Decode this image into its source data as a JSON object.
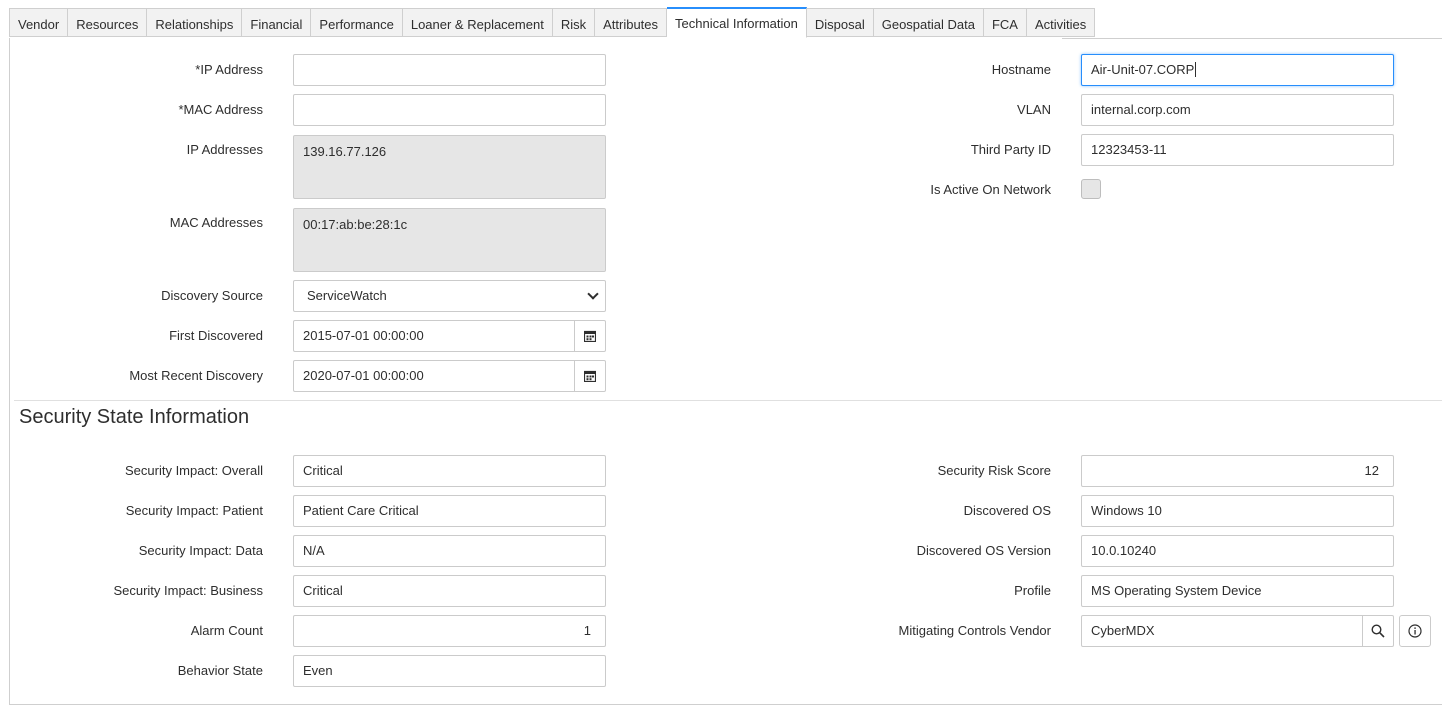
{
  "tabs": [
    "Vendor",
    "Resources",
    "Relationships",
    "Financial",
    "Performance",
    "Loaner & Replacement",
    "Risk",
    "Attributes",
    "Technical Information",
    "Disposal",
    "Geospatial Data",
    "FCA",
    "Activities"
  ],
  "active_tab": "Technical Information",
  "technical": {
    "ip_address": {
      "label": "*IP Address",
      "value": ""
    },
    "mac_address": {
      "label": "*MAC Address",
      "value": ""
    },
    "ip_addresses": {
      "label": "IP Addresses",
      "value": "139.16.77.126"
    },
    "mac_addresses": {
      "label": "MAC Addresses",
      "value": "00:17:ab:be:28:1c"
    },
    "discovery_source": {
      "label": "Discovery Source",
      "value": "ServiceWatch"
    },
    "first_discovered": {
      "label": "First Discovered",
      "value": "2015-07-01 00:00:00"
    },
    "most_recent_discovery": {
      "label": "Most Recent Discovery",
      "value": "2020-07-01 00:00:00"
    },
    "hostname": {
      "label": "Hostname",
      "value": "Air-Unit-07.CORP"
    },
    "vlan": {
      "label": "VLAN",
      "value": "internal.corp.com"
    },
    "third_party_id": {
      "label": "Third Party ID",
      "value": "12323453-11"
    },
    "is_active_on_network": {
      "label": "Is Active On Network",
      "checked": false
    }
  },
  "security": {
    "title": "Security State Information",
    "impact_overall": {
      "label": "Security Impact: Overall",
      "value": "Critical"
    },
    "impact_patient": {
      "label": "Security Impact: Patient",
      "value": "Patient Care Critical"
    },
    "impact_data": {
      "label": "Security Impact: Data",
      "value": "N/A"
    },
    "impact_business": {
      "label": "Security Impact: Business",
      "value": "Critical"
    },
    "alarm_count": {
      "label": "Alarm Count",
      "value": "1"
    },
    "behavior_state": {
      "label": "Behavior State",
      "value": "Even"
    },
    "risk_score": {
      "label": "Security Risk Score",
      "value": "12"
    },
    "discovered_os": {
      "label": "Discovered OS",
      "value": "Windows 10"
    },
    "discovered_os_version": {
      "label": "Discovered OS Version",
      "value": "10.0.10240"
    },
    "profile": {
      "label": "Profile",
      "value": "MS Operating System Device"
    },
    "mitigating_vendor": {
      "label": "Mitigating Controls Vendor",
      "value": "CyberMDX"
    }
  },
  "icons": {
    "calendar": "calendar-icon",
    "search": "search-icon",
    "info": "info-icon",
    "dropdown": "chevron-down-icon"
  }
}
